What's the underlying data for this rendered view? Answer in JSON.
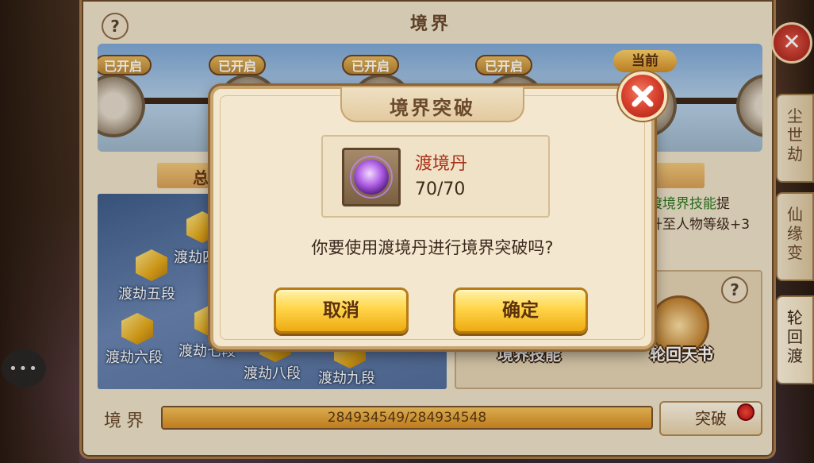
{
  "background_panel": {
    "title": "境界",
    "help_glyph": "?",
    "stage_tags": [
      "已开启",
      "已开启",
      "已开启",
      "已开启"
    ],
    "current_tag": "当前",
    "summary_text": "总",
    "tribulations": [
      {
        "label": "渡劫四"
      },
      {
        "label": "渡劫五段"
      },
      {
        "label": "渡劫六段"
      },
      {
        "label": "渡劫七段"
      },
      {
        "label": "渡劫八段"
      },
      {
        "label": "渡劫九段"
      }
    ],
    "skill_info_line1_prefix": "渡境界技能",
    "skill_info_line1_suffix": "提",
    "skill_info_line2": "升至人物等级+3",
    "skill_buttons": {
      "realm_skill": "境界技能",
      "reincarnation_book": "轮回天书"
    },
    "realm_label": "境界",
    "exp_text": "284934549/284934548",
    "exp_fraction": 1.0,
    "breakthrough_button": "突破"
  },
  "side_tabs": [
    {
      "label": "尘世劫"
    },
    {
      "label": "仙缘变"
    },
    {
      "label": "轮回渡"
    }
  ],
  "dialog": {
    "title": "境界突破",
    "item": {
      "name": "渡境丹",
      "count": "70/70",
      "icon_glyph": "境"
    },
    "question": "你要使用渡境丹进行境界突破吗?",
    "cancel_label": "取消",
    "confirm_label": "确定"
  },
  "chat_glyph": "•••",
  "colors": {
    "accent_gold": "#eeab12",
    "close_red": "#d63f2c",
    "item_name_red": "#a8331a"
  }
}
